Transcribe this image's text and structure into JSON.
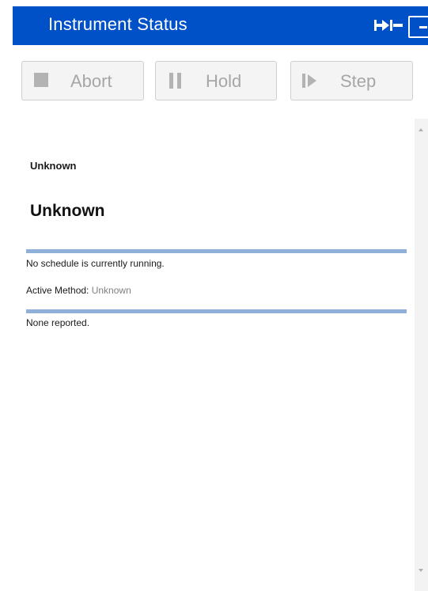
{
  "window": {
    "title": "Instrument Status"
  },
  "toolbar": {
    "abort_label": "Abort",
    "hold_label": "Hold",
    "step_label": "Step"
  },
  "status": {
    "small_heading": "Unknown",
    "large_heading": "Unknown",
    "schedule_text": "No schedule is currently running.",
    "active_method_label": "Active Method:",
    "active_method_value": "Unknown",
    "reported_text": "None reported."
  },
  "icons": {
    "abort": "stop-square-icon",
    "hold": "pause-icon",
    "step": "step-forward-icon",
    "pin": "pin-icon",
    "minimize": "minimize-icon",
    "scroll_up": "scroll-up-arrow-icon",
    "scroll_down": "scroll-down-arrow-icon"
  },
  "colors": {
    "titlebar": "#0050c8",
    "separator": "#8fb0d8",
    "disabled_text": "#a6a6a6"
  }
}
